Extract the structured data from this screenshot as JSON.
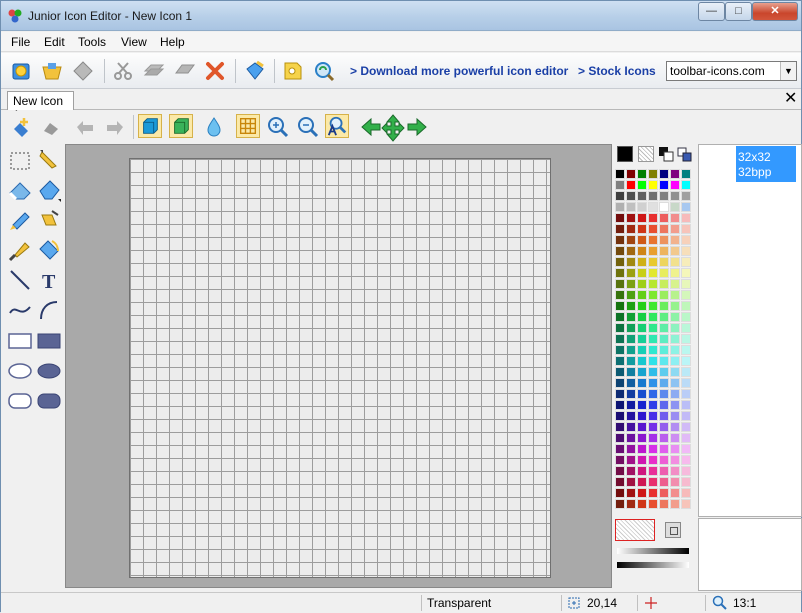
{
  "window": {
    "title": "Junior Icon Editor - New Icon 1",
    "controls": {
      "minimize": "—",
      "maximize": "□",
      "close": "✕"
    }
  },
  "menu": [
    "File",
    "Edit",
    "Tools",
    "View",
    "Help"
  ],
  "toolbar": {
    "buttons": [
      "new-icon",
      "open-icon",
      "save-icon",
      "cut-icon",
      "copy-icon",
      "paste-icon",
      "delete-icon",
      "paint-bucket-icon",
      "key-icon",
      "refresh-search-icon"
    ],
    "link_download": "> Download more powerful icon editor",
    "link_stock": "> Stock Icons",
    "url_combo_value": "toolbar-icons.com"
  },
  "tabs": {
    "document_tab": "New Icon 1",
    "close": "✕"
  },
  "toolbar2": {
    "buttons": [
      "add-image-icon",
      "pin-icon",
      "undo-icon",
      "redo-icon",
      "cube-icon",
      "cube-outline-icon",
      "droplet-icon",
      "grid-icon",
      "zoom-in-icon",
      "zoom-out-icon",
      "zoom-actual-icon",
      "arrow-left-icon",
      "arrow-move-icon",
      "arrow-right-icon"
    ]
  },
  "tools": [
    "select-rect-tool",
    "pencil-tool",
    "eraser-tool",
    "fill-tool",
    "brush-tool",
    "airbrush-tool",
    "picker-tool",
    "paint-bucket-tool",
    "line-tool",
    "text-tool",
    "curve-tool",
    "arc-tool",
    "rect-outline-tool",
    "rect-filled-tool",
    "ellipse-outline-tool",
    "ellipse-filled-tool",
    "roundrect-outline-tool",
    "roundrect-filled-tool"
  ],
  "text_tool_glyph": "T",
  "sizes": [
    {
      "label_line1": "32x32",
      "label_line2": "32bpp"
    }
  ],
  "status": {
    "color_label": "Transparent",
    "coords": "20,14",
    "zoom": "13:1"
  },
  "colors": {
    "selection": "#3399ff",
    "tool_blue": "#5a6494",
    "link_blue": "#1a3fa6",
    "close_red": "#c9462c"
  }
}
